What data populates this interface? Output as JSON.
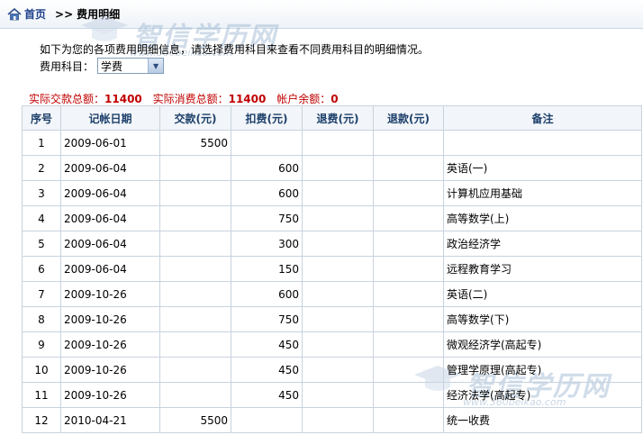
{
  "breadcrumb": {
    "home": "首页",
    "separator": ">>",
    "current": "费用明细"
  },
  "intro_text": "如下为您的各项费用明细信息，请选择费用科目来查看不同费用科目的明细情况。",
  "filter": {
    "label": "费用科目：",
    "selected": "学费"
  },
  "summary": {
    "paid_label": "实际交款总额：",
    "paid_value": "11400",
    "consumed_label": "实际消费总额：",
    "consumed_value": "11400",
    "balance_label": "帐户余额：",
    "balance_value": "0"
  },
  "table": {
    "headers": [
      "序号",
      "记帐日期",
      "交款(元)",
      "扣费(元)",
      "退费(元)",
      "退款(元)",
      "备注"
    ],
    "rows": [
      {
        "seq": "1",
        "date": "2009-06-01",
        "paid": "5500",
        "deduct": "",
        "refund_fee": "",
        "refund": "",
        "note": ""
      },
      {
        "seq": "2",
        "date": "2009-06-04",
        "paid": "",
        "deduct": "600",
        "refund_fee": "",
        "refund": "",
        "note": "英语(一)"
      },
      {
        "seq": "3",
        "date": "2009-06-04",
        "paid": "",
        "deduct": "600",
        "refund_fee": "",
        "refund": "",
        "note": "计算机应用基础"
      },
      {
        "seq": "4",
        "date": "2009-06-04",
        "paid": "",
        "deduct": "750",
        "refund_fee": "",
        "refund": "",
        "note": "高等数学(上)"
      },
      {
        "seq": "5",
        "date": "2009-06-04",
        "paid": "",
        "deduct": "300",
        "refund_fee": "",
        "refund": "",
        "note": "政治经济学"
      },
      {
        "seq": "6",
        "date": "2009-06-04",
        "paid": "",
        "deduct": "150",
        "refund_fee": "",
        "refund": "",
        "note": "远程教育学习"
      },
      {
        "seq": "7",
        "date": "2009-10-26",
        "paid": "",
        "deduct": "600",
        "refund_fee": "",
        "refund": "",
        "note": "英语(二)"
      },
      {
        "seq": "8",
        "date": "2009-10-26",
        "paid": "",
        "deduct": "750",
        "refund_fee": "",
        "refund": "",
        "note": "高等数学(下)"
      },
      {
        "seq": "9",
        "date": "2009-10-26",
        "paid": "",
        "deduct": "450",
        "refund_fee": "",
        "refund": "",
        "note": "微观经济学(高起专)"
      },
      {
        "seq": "10",
        "date": "2009-10-26",
        "paid": "",
        "deduct": "450",
        "refund_fee": "",
        "refund": "",
        "note": "管理学原理(高起专)"
      },
      {
        "seq": "11",
        "date": "2009-10-26",
        "paid": "",
        "deduct": "450",
        "refund_fee": "",
        "refund": "",
        "note": "经济法学(高起专)"
      },
      {
        "seq": "12",
        "date": "2010-04-21",
        "paid": "5500",
        "deduct": "",
        "refund_fee": "",
        "refund": "",
        "note": "统一收费"
      }
    ]
  },
  "watermarks": [
    {
      "text": "智信学历网",
      "url": "www.360beikao.com"
    },
    {
      "text": "智信学历网",
      "url": "www.360beikao.com"
    }
  ],
  "colors": {
    "link": "#1c3f8a",
    "summary": "#c00000",
    "header_text": "#1c3f6a",
    "border": "#c8d3df"
  }
}
